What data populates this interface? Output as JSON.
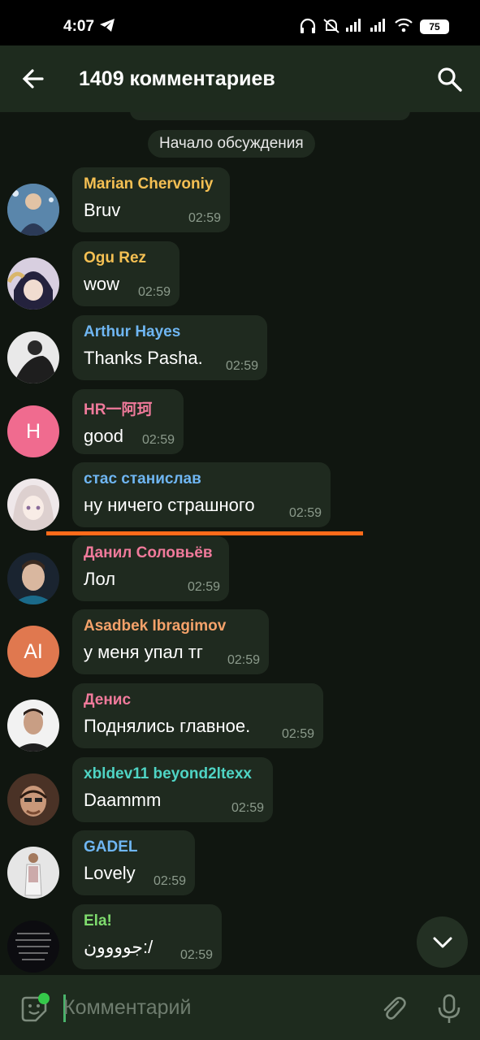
{
  "status_bar": {
    "time": "4:07",
    "battery": "75"
  },
  "header": {
    "title": "1409 комментариев"
  },
  "chat": {
    "date_pill": "Начало обсуждения",
    "messages": [
      {
        "sender": "Marian Chervoniy",
        "text": "Bruv",
        "time": "02:59",
        "color": "#f5c053"
      },
      {
        "sender": "Ogu Rez",
        "text": "wow",
        "time": "02:59",
        "color": "#f5c053"
      },
      {
        "sender": "Arthur Hayes",
        "text": "Thanks Pasha.",
        "time": "02:59",
        "color": "#6fb6f2"
      },
      {
        "sender": "HR一阿珂",
        "text": "good",
        "time": "02:59",
        "color": "#f07a9b",
        "avatar_letter": "H",
        "avatar_color": "#f06b8f"
      },
      {
        "sender": "стас станислав",
        "text": "ну ничего страшного",
        "time": "02:59",
        "color": "#6fb6f2"
      },
      {
        "sender": "Данил Соловьёв",
        "text": "Лол",
        "time": "02:59",
        "color": "#f07a9b"
      },
      {
        "sender": "Asadbek Ibragimov",
        "text": "у меня упал тг",
        "time": "02:59",
        "color": "#f5a26a",
        "avatar_letter": "AI",
        "avatar_color": "#e0784f"
      },
      {
        "sender": "Денис",
        "text": "Поднялись главное.",
        "time": "02:59",
        "color": "#f07a9b"
      },
      {
        "sender": "xbldev11 beyond2ltexx",
        "text": "Daammm",
        "time": "02:59",
        "color": "#4fd4c4"
      },
      {
        "sender": "GADEL",
        "text": "Lovely",
        "time": "02:59",
        "color": "#6fb6f2"
      },
      {
        "sender": "Ela!",
        "text": "جوووون:/",
        "time": "02:59",
        "color": "#7fdc6e"
      }
    ]
  },
  "input": {
    "placeholder": "Комментарий"
  },
  "colors": {
    "accent": "#49b36b",
    "highlight": "#ff6b1a",
    "bubble": "#1f2a1f",
    "header": "#1e2b1e"
  },
  "icons": {
    "back": "arrow-left-icon",
    "search": "search-icon",
    "scroll": "chevron-down-icon",
    "sticker": "sticker-icon",
    "attach": "paperclip-icon",
    "mic": "microphone-icon"
  }
}
